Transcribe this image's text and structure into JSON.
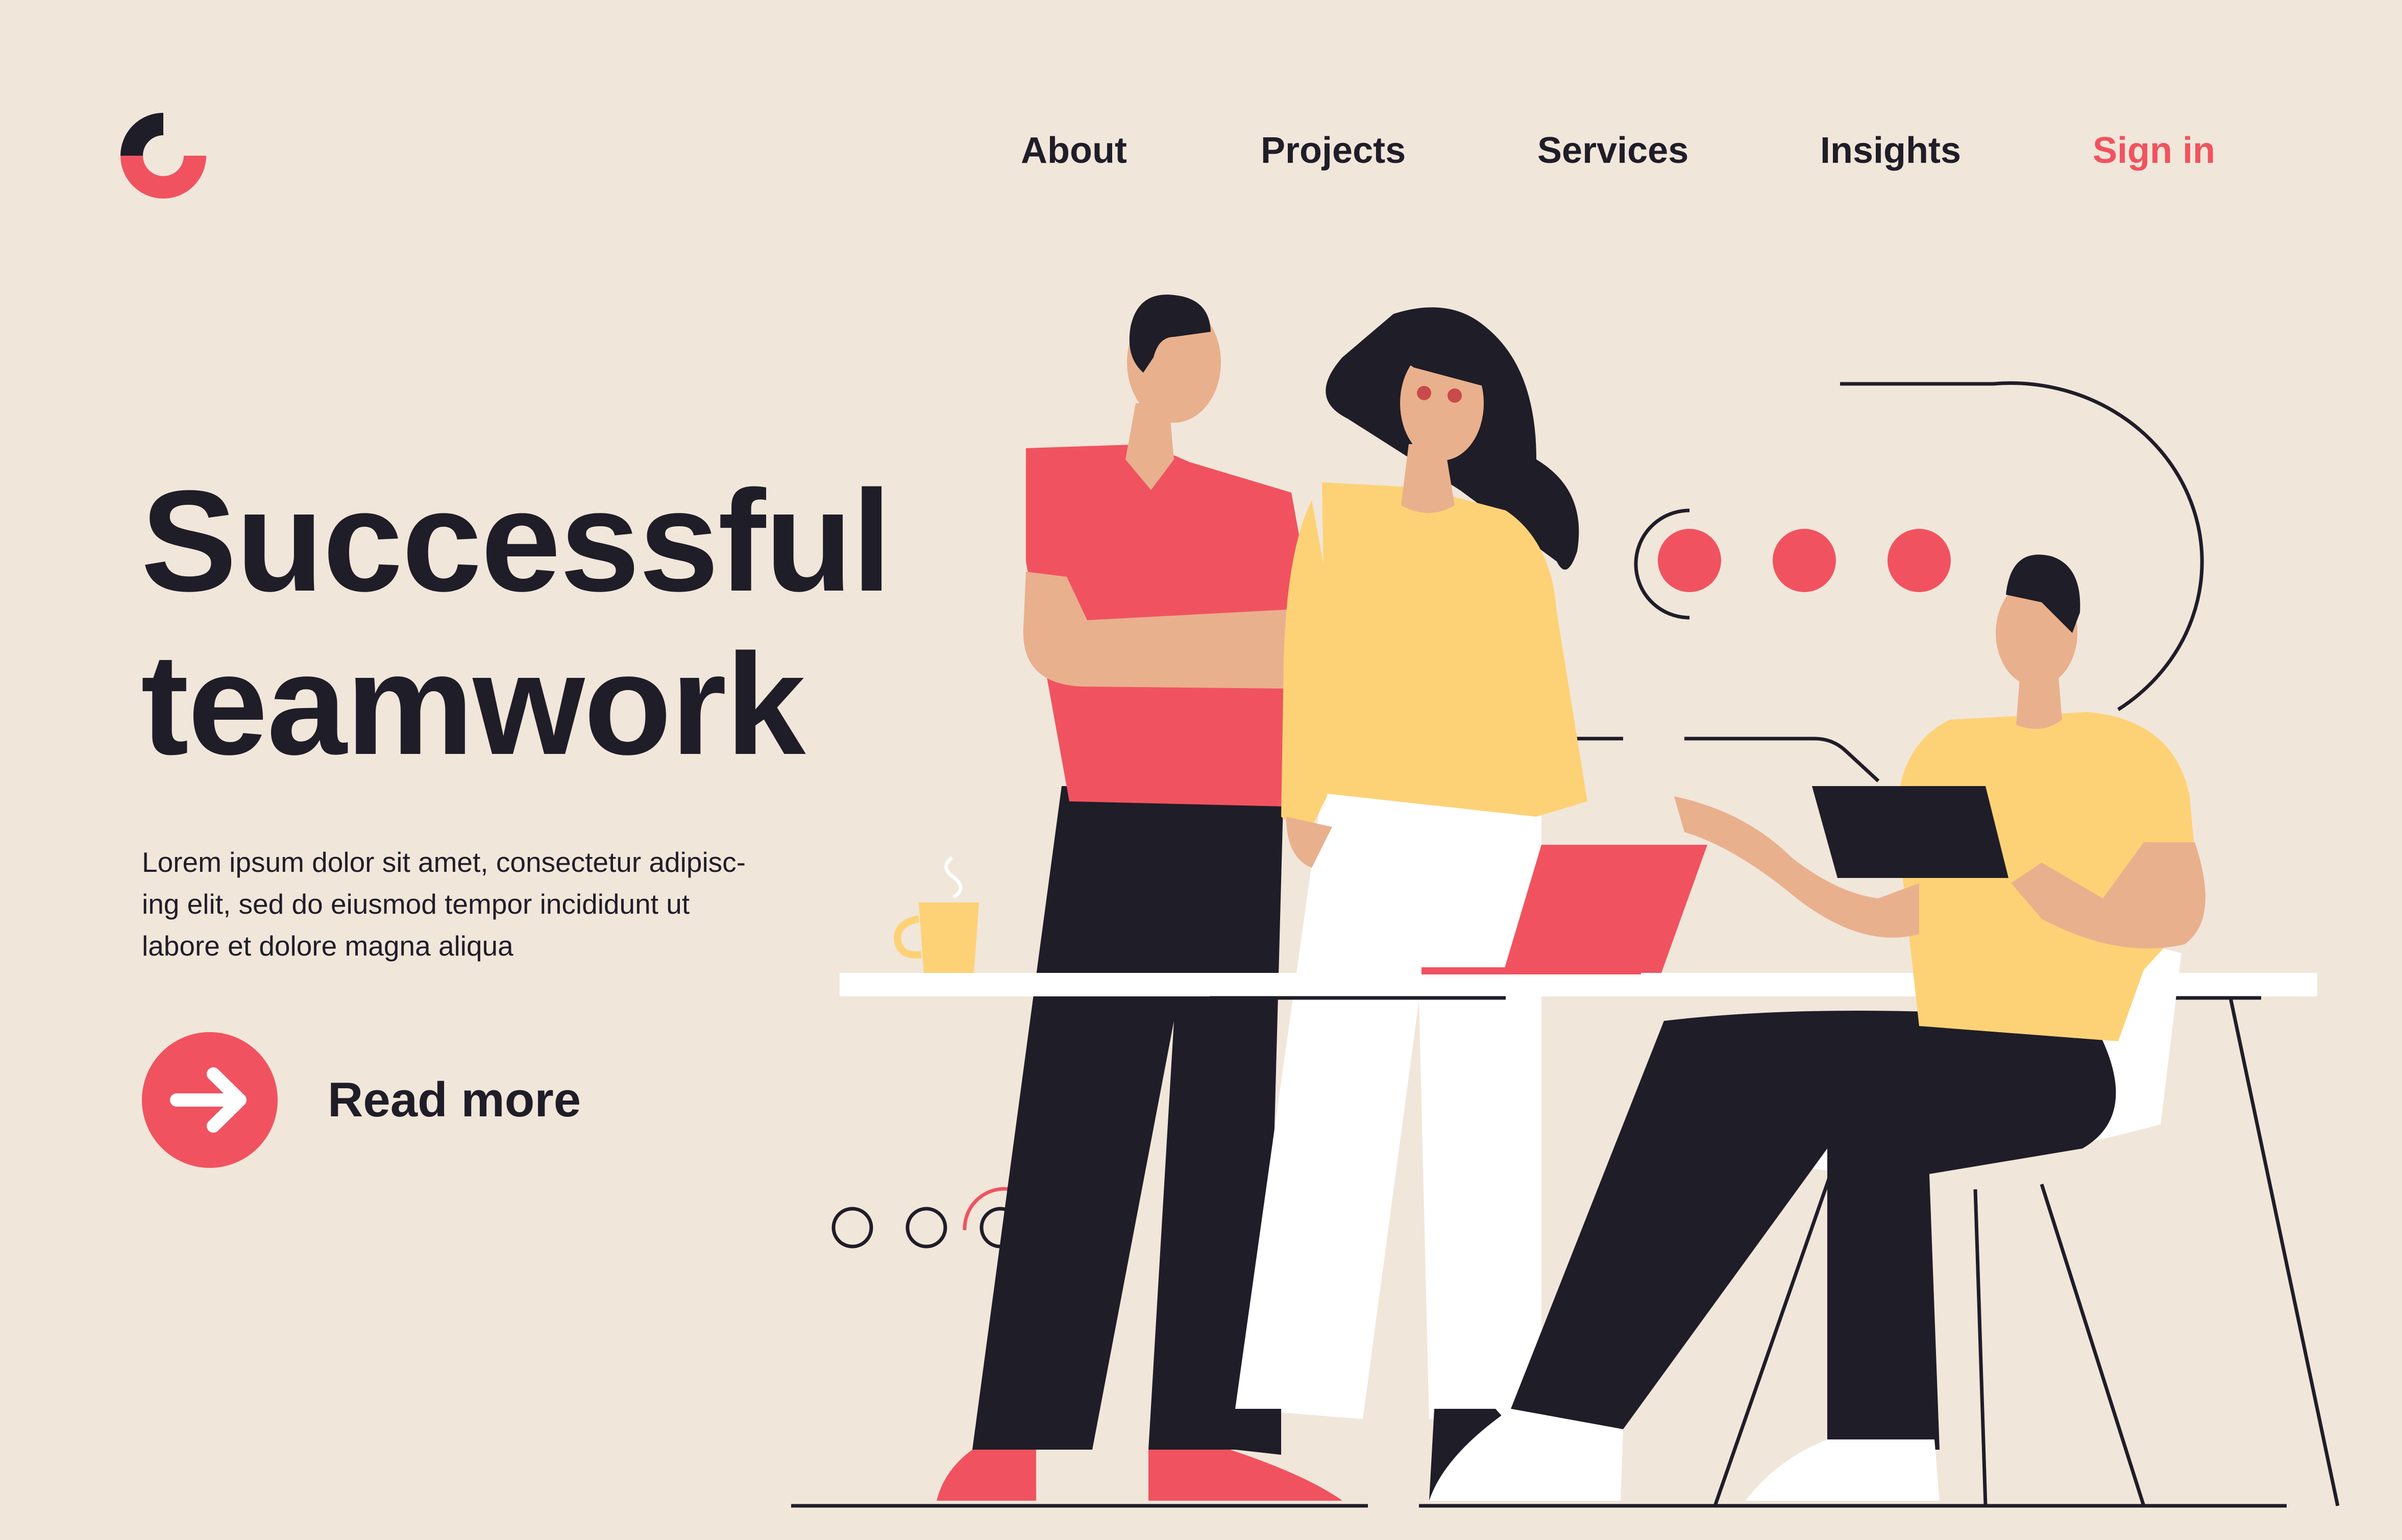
{
  "brand": {
    "logo_icon": "ring-logo-icon",
    "primary_color": "#f0535f",
    "dark_color": "#1f1d28",
    "background_color": "#f1e6da",
    "yellow_color": "#fdd276"
  },
  "nav": {
    "items": [
      {
        "label": "About"
      },
      {
        "label": "Projects"
      },
      {
        "label": "Services"
      },
      {
        "label": "Insights"
      }
    ],
    "sign_in": "Sign in"
  },
  "hero": {
    "title_line1": "Successful",
    "title_line2": "teamwork",
    "description_lines": [
      "Lorem ipsum dolor sit amet, consectetur adipisc-",
      "ing elit, sed do eiusmod tempor incididunt ut",
      "labore et dolore magna aliqua"
    ]
  },
  "cta": {
    "label": "Read more",
    "icon": "arrow-right-icon"
  }
}
